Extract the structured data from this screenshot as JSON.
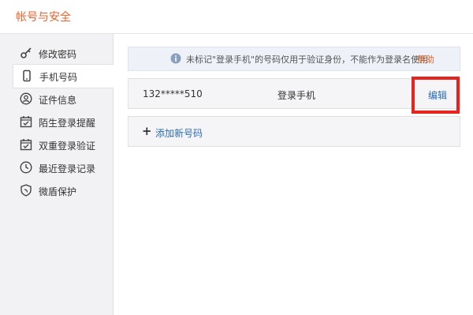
{
  "header": {
    "title": "帐号与安全"
  },
  "sidebar": {
    "items": [
      {
        "label": "修改密码",
        "icon": "key-icon"
      },
      {
        "label": "手机号码",
        "icon": "phone-icon",
        "active": true
      },
      {
        "label": "证件信息",
        "icon": "id-card-icon"
      },
      {
        "label": "陌生登录提醒",
        "icon": "calendar-alert-icon"
      },
      {
        "label": "双重登录验证",
        "icon": "calendar-check-icon"
      },
      {
        "label": "最近登录记录",
        "icon": "clock-icon"
      },
      {
        "label": "微盾保护",
        "icon": "shield-icon"
      }
    ]
  },
  "main": {
    "notice": {
      "text": "未标记\"登录手机\"的号码仅用于验证身份，不能作为登录名使用",
      "help": "帮助",
      "icon": "info-icon"
    },
    "phone_row": {
      "number": "132*****510",
      "tag": "登录手机",
      "edit": "编辑"
    },
    "add": {
      "label": "添加新号码",
      "icon": "plus-icon"
    }
  },
  "colors": {
    "accent": "#e8632b",
    "link": "#2b6cb5",
    "highlight": "#e8231f"
  }
}
